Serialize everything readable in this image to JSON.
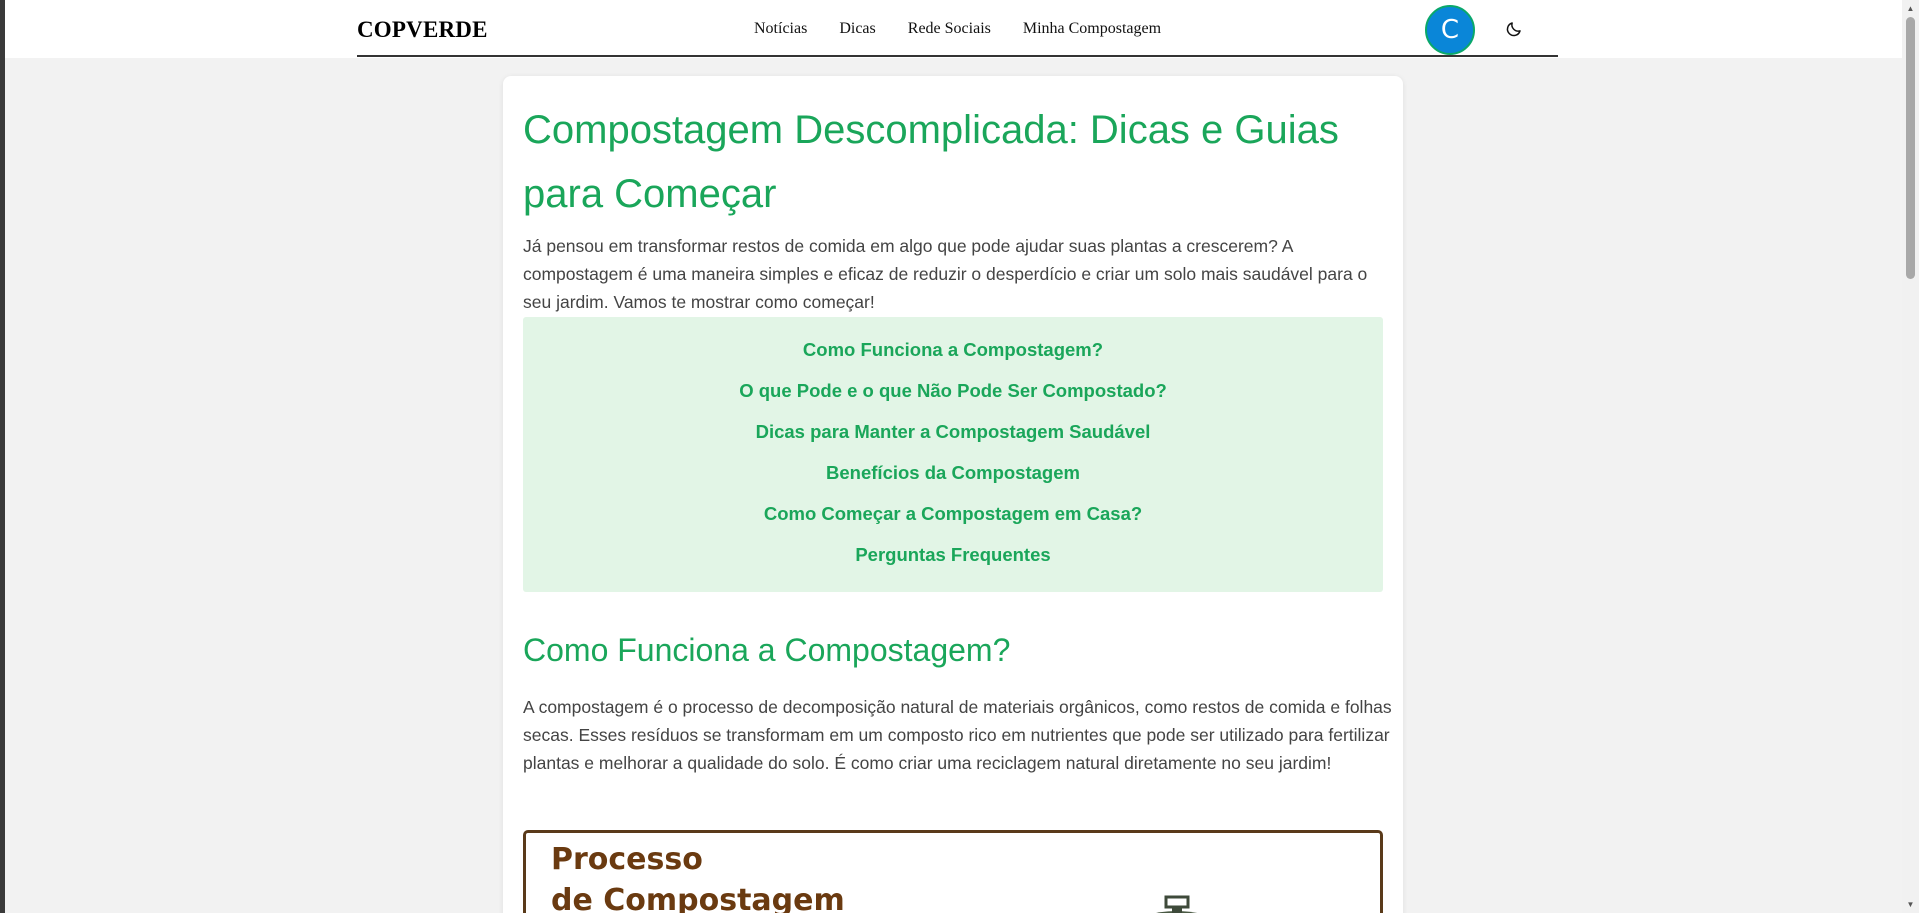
{
  "header": {
    "brand": "COPVERDE",
    "nav": [
      "Notícias",
      "Dicas",
      "Rede Sociais",
      "Minha Compostagem"
    ],
    "avatar_letter": "C"
  },
  "article": {
    "title": "Compostagem Descomplicada: Dicas e Guias para Começar",
    "intro": "Já pensou em transformar restos de comida em algo que pode ajudar suas plantas a crescerem? A compostagem é uma maneira simples e eficaz de reduzir o desperdício e criar um solo mais saudável para o seu jardim. Vamos te mostrar como começar!",
    "toc": [
      "Como Funciona a Compostagem?",
      "O que Pode e o que Não Pode Ser Compostado?",
      "Dicas para Manter a Compostagem Saudável",
      "Benefícios da Compostagem",
      "Como Começar a Compostagem em Casa?",
      "Perguntas Frequentes"
    ],
    "section1": {
      "heading": "Como Funciona a Compostagem?",
      "body": "A compostagem é o processo de decomposição natural de materiais orgânicos, como restos de comida e folhas secas. Esses resíduos se transformam em um composto rico em nutrientes que pode ser utilizado para fertilizar plantas e melhorar a qualidade do solo. É como criar uma reciclagem natural diretamente no seu jardim!"
    },
    "figure": {
      "line1": "Processo",
      "line2": "de Compostagem"
    }
  },
  "colors": {
    "accent": "#1aa65a",
    "toc_bg": "#e2f5e6",
    "avatar": "#0a86d8"
  },
  "icons": [
    "moon-icon"
  ]
}
